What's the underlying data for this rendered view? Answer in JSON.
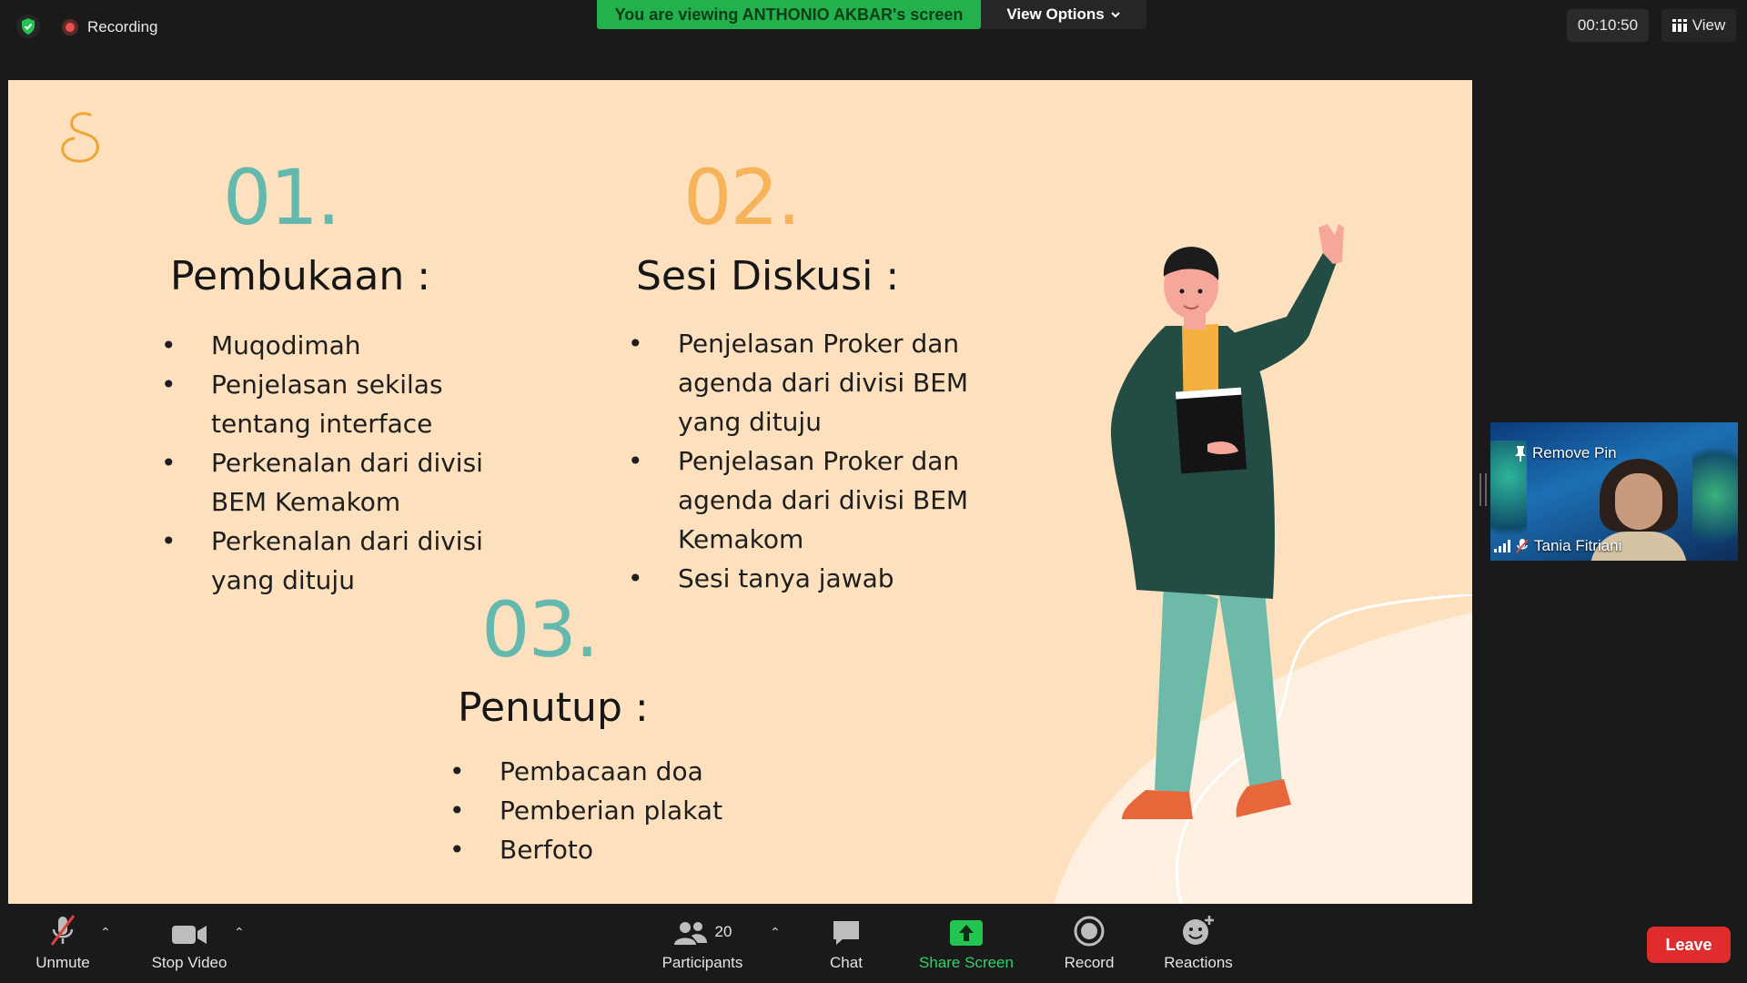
{
  "topbar": {
    "recording_label": "Recording",
    "viewing_banner": "You are viewing ANTHONIO AKBAR's screen",
    "view_options_label": "View Options",
    "timer": "00:10:50",
    "view_label": "View"
  },
  "slide": {
    "sections": [
      {
        "number": "01.",
        "heading": "Pembukaan :",
        "items": [
          "Muqodimah",
          "Penjelasan sekilas tentang interface",
          "Perkenalan dari divisi BEM Kemakom",
          "Perkenalan dari divisi yang dituju"
        ],
        "item_lines": [
          [
            "Muqodimah"
          ],
          [
            "Penjelasan sekilas",
            "tentang interface"
          ],
          [
            "Perkenalan dari divisi",
            "BEM Kemakom"
          ],
          [
            "Perkenalan dari divisi",
            "yang dituju"
          ]
        ]
      },
      {
        "number": "02.",
        "heading": "Sesi Diskusi :",
        "items": [
          "Penjelasan Proker dan agenda dari divisi BEM yang dituju",
          "Penjelasan Proker dan agenda dari divisi BEM Kemakom",
          "Sesi tanya jawab"
        ],
        "item_lines": [
          [
            "Penjelasan Proker dan",
            "agenda dari divisi BEM",
            "yang dituju"
          ],
          [
            "Penjelasan Proker dan",
            "agenda dari divisi BEM",
            "Kemakom"
          ],
          [
            "Sesi tanya jawab"
          ]
        ]
      },
      {
        "number": "03.",
        "heading": "Penutup :",
        "items": [
          "Pembacaan doa",
          "Pemberian plakat",
          "Berfoto"
        ],
        "item_lines": [
          [
            "Pembacaan doa"
          ],
          [
            "Pemberian plakat"
          ],
          [
            "Berfoto"
          ]
        ]
      }
    ],
    "colors": {
      "background": "#fde0bd",
      "teal": "#63b9ad",
      "orange": "#f7b35a"
    }
  },
  "video_tile": {
    "remove_pin_label": "Remove Pin",
    "participant_name": "Tania Fitriani"
  },
  "toolbar": {
    "unmute_label": "Unmute",
    "stop_video_label": "Stop Video",
    "participants_label": "Participants",
    "participants_count": "20",
    "chat_label": "Chat",
    "share_screen_label": "Share Screen",
    "record_label": "Record",
    "reactions_label": "Reactions",
    "leave_label": "Leave"
  },
  "colors": {
    "share_green": "#22b14c",
    "leave_red": "#e02c2c"
  }
}
